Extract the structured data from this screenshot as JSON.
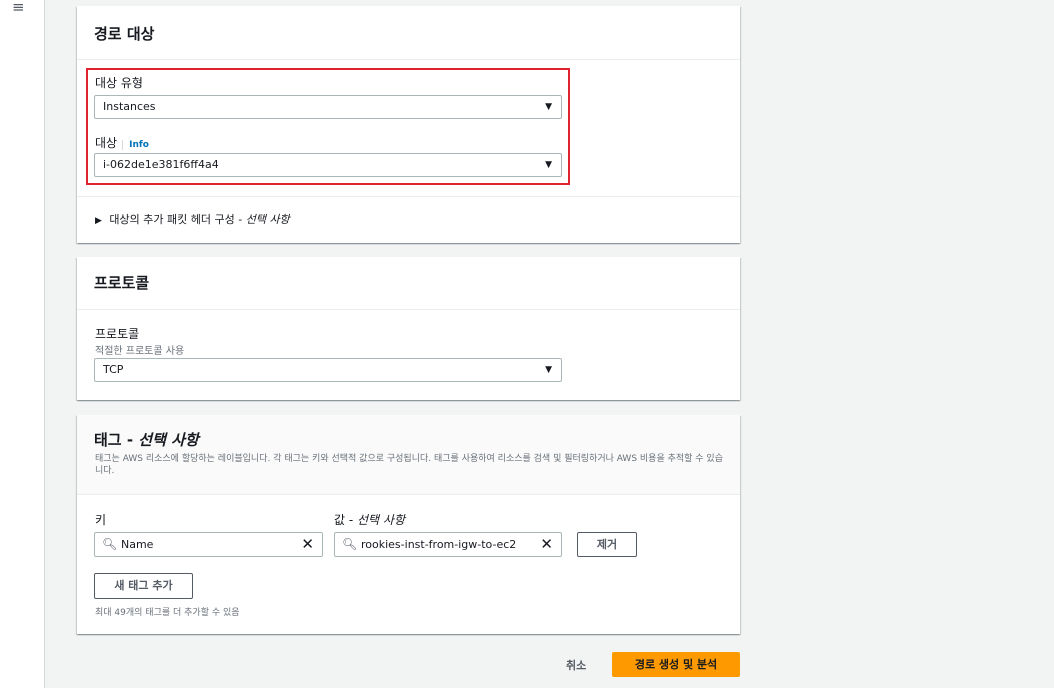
{
  "nav": {
    "menu_icon": "≡"
  },
  "route_target": {
    "title": "경로 대상",
    "target_type_label": "대상 유형",
    "target_type_value": "Instances",
    "target_label": "대상",
    "info_link": "Info",
    "target_value": "i-062de1e381f6ff4a4",
    "expand_label": "대상의 추가 패킷 헤더 구성",
    "expand_optional": "선택 사항"
  },
  "protocol": {
    "title": "프로토콜",
    "field_label": "프로토콜",
    "field_desc": "적절한 프로토콜 사용",
    "value": "TCP"
  },
  "tags": {
    "title": "태그",
    "title_optional": "선택 사항",
    "description": "태그는 AWS 리소스에 할당하는 레이블입니다. 각 태그는 키와 선택적 값으로 구성됩니다. 태그를 사용하여 리소스를 검색 및 필터링하거나 AWS 비용을 추적할 수 있습니다.",
    "key_label": "키",
    "value_label": "값",
    "value_optional": "선택 사항",
    "key_value": "Name",
    "value_value": "rookies-inst-from-igw-to-ec2",
    "remove_button": "제거",
    "add_button": "새 태그 추가",
    "limit_note": "최대 49개의 태그를 더 추가할 수 있음"
  },
  "footer": {
    "cancel": "취소",
    "submit": "경로 생성 및 분석"
  },
  "colors": {
    "highlight_border": "#e0232e",
    "primary_button": "#ff9900",
    "link": "#0073bb"
  }
}
